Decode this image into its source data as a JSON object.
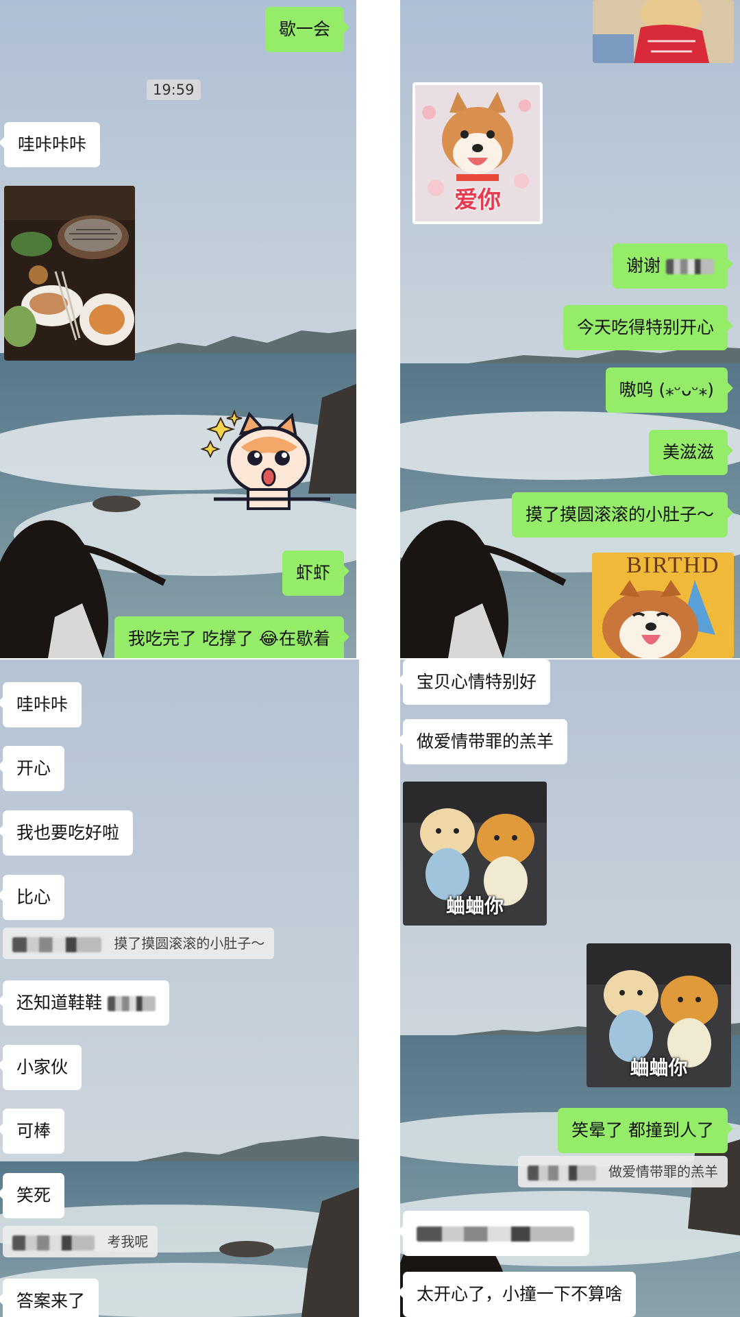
{
  "panel_top_left": {
    "sent_rest": "歇一会",
    "timestamp": "19:59",
    "recv_wow": "哇咔咔咔",
    "food_photo_icon": "bbq-food-photo",
    "sticker_icon": "corgi-excited-sticker",
    "sent_shrimp": "虾虾",
    "sent_full": "我吃完了 吃撑了 😂在歇着"
  },
  "panel_top_right": {
    "birthday_top_icon": "bear-toy-photo",
    "love_sticker_caption": "爱你",
    "sent_thanks": "谢谢",
    "sent_happy_today": "今天吃得特别开心",
    "sent_awoo": "嗷呜 (⁎ᵕᴗᵕ⁎)",
    "sent_yummy": "美滋滋",
    "sent_belly": "摸了摸圆滚滚的小肚子～",
    "birthday_dog_text": "BIRTHD"
  },
  "panel_bottom_left": {
    "recv_wow": "哇咔咔",
    "recv_happy": "开心",
    "recv_eat_well": "我也要吃好啦",
    "recv_heart": "比心",
    "quote_belly": "摸了摸圆滚滚的小肚子～",
    "recv_shoes": "还知道鞋鞋",
    "recv_little": "小家伙",
    "recv_great": "可棒",
    "recv_lol": "笑死",
    "quote_test": "考我呢",
    "recv_answer": "答案来了"
  },
  "panel_bottom_right": {
    "recv_good_mood": "宝贝心情特别好",
    "recv_scapegoat": "做爱情带罪的羔羊",
    "sticker_caption_1": "蛐蛐你",
    "sticker_caption_2": "蛐蛐你",
    "sent_bump": "笑晕了 都撞到人了",
    "quote_scapegoat": "做爱情带罪的羔羊",
    "recv_bump_ok": "太开心了，小撞一下不算啥"
  }
}
